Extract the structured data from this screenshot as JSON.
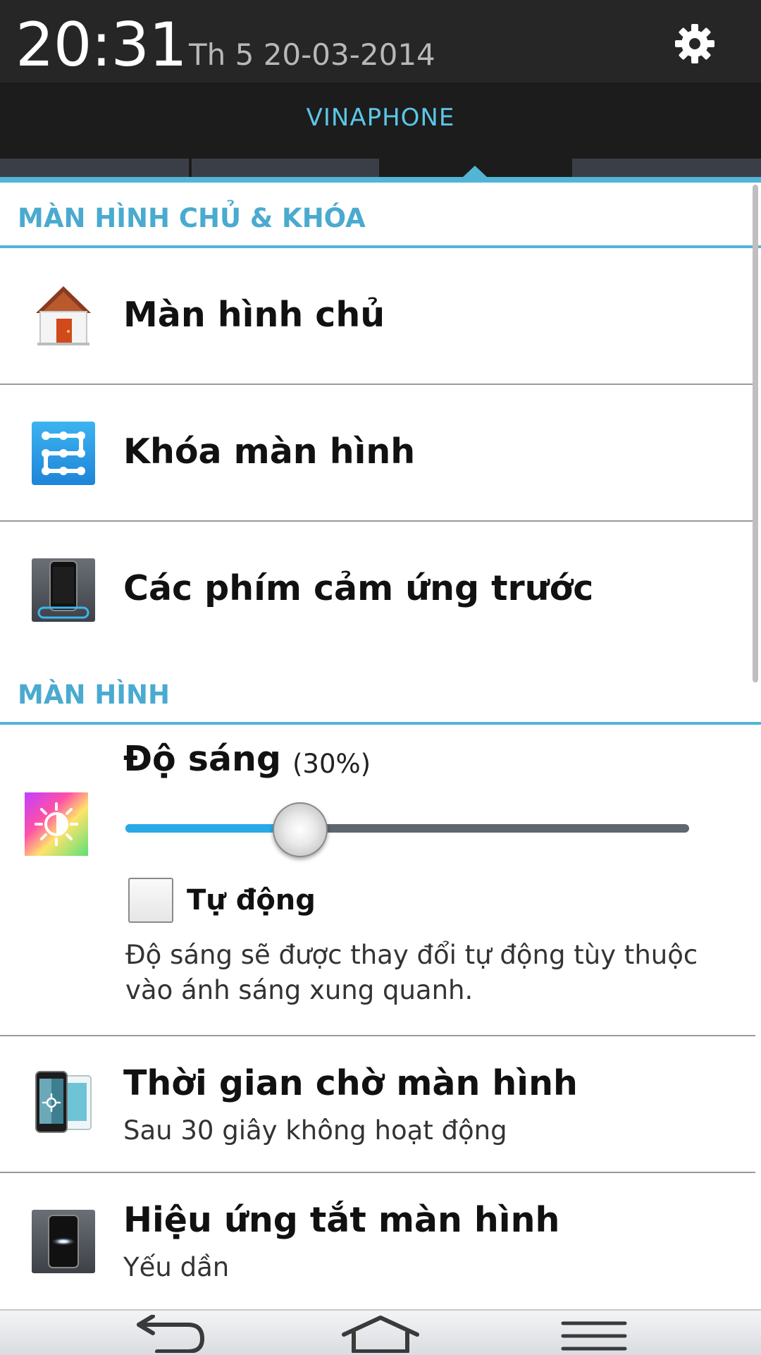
{
  "status_bar": {
    "time": "20:31",
    "date": "Th 5 20-03-2014",
    "settings_icon": "gear-icon"
  },
  "carrier": "VINAPHONE",
  "sections": {
    "home_lock": {
      "header": "MÀN HÌNH CHỦ & KHÓA",
      "items": [
        {
          "title": "Màn hình chủ",
          "icon": "home-icon"
        },
        {
          "title": "Khóa màn hình",
          "icon": "lock-pattern-icon"
        },
        {
          "title": "Các phím cảm ứng trước",
          "icon": "touch-keys-icon"
        }
      ]
    },
    "display": {
      "header": "MÀN HÌNH",
      "brightness": {
        "title": "Độ sáng",
        "percent_label": "(30%)",
        "level": 0.3,
        "auto_label": "Tự động",
        "auto_checked": false,
        "description": "Độ sáng sẽ được thay đổi tự động tùy thuộc vào ánh sáng xung quanh.",
        "icon": "brightness-icon"
      },
      "items": [
        {
          "title": "Thời gian chờ màn hình",
          "subtitle": "Sau 30 giây không hoạt động",
          "icon": "screen-timeout-icon"
        },
        {
          "title": "Hiệu ứng tắt màn hình",
          "subtitle": "Yếu dần",
          "icon": "screen-off-effect-icon"
        }
      ]
    }
  },
  "nav": {
    "back_icon": "back-icon",
    "home_icon": "home-nav-icon",
    "menu_icon": "menu-icon"
  },
  "colors": {
    "accent": "#52b5d6",
    "header_text": "#4aaacf",
    "slider_fill": "#27aae6"
  }
}
